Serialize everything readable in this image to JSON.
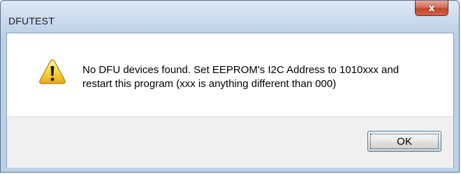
{
  "dialog": {
    "title": "DFUTEST",
    "close_label": "x",
    "message_lines": [
      "No DFU devices found. Set EEPROM's I2C Address to 1010xxx and",
      "restart this program (xxx is anything different than 000)"
    ],
    "icon": "warning-icon",
    "ok_label": "OK"
  }
}
